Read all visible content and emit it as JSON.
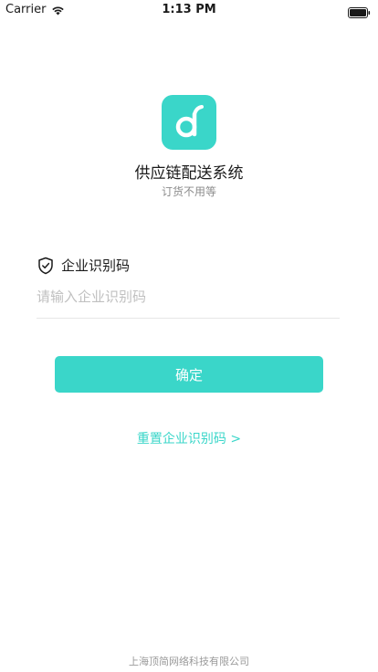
{
  "status_bar": {
    "carrier": "Carrier",
    "time": "1:13 PM",
    "wifi_icon": "wifi-icon",
    "battery_icon": "battery-full-icon"
  },
  "app": {
    "logo_icon": "app-logo-icon",
    "title": "供应链配送系统",
    "subtitle": "订货不用等"
  },
  "form": {
    "field_icon": "shield-check-icon",
    "field_label": "企业识别码",
    "input_value": "",
    "input_placeholder": "请输入企业识别码",
    "confirm_label": "确定",
    "reset_link": "重置企业识别码 >"
  },
  "footer": {
    "company": "上海顶简网络科技有限公司"
  },
  "colors": {
    "accent": "#3ad6c9",
    "placeholder": "#c0c0c0",
    "subtitle": "#8c8c8c",
    "footer": "#9a9a9a"
  }
}
